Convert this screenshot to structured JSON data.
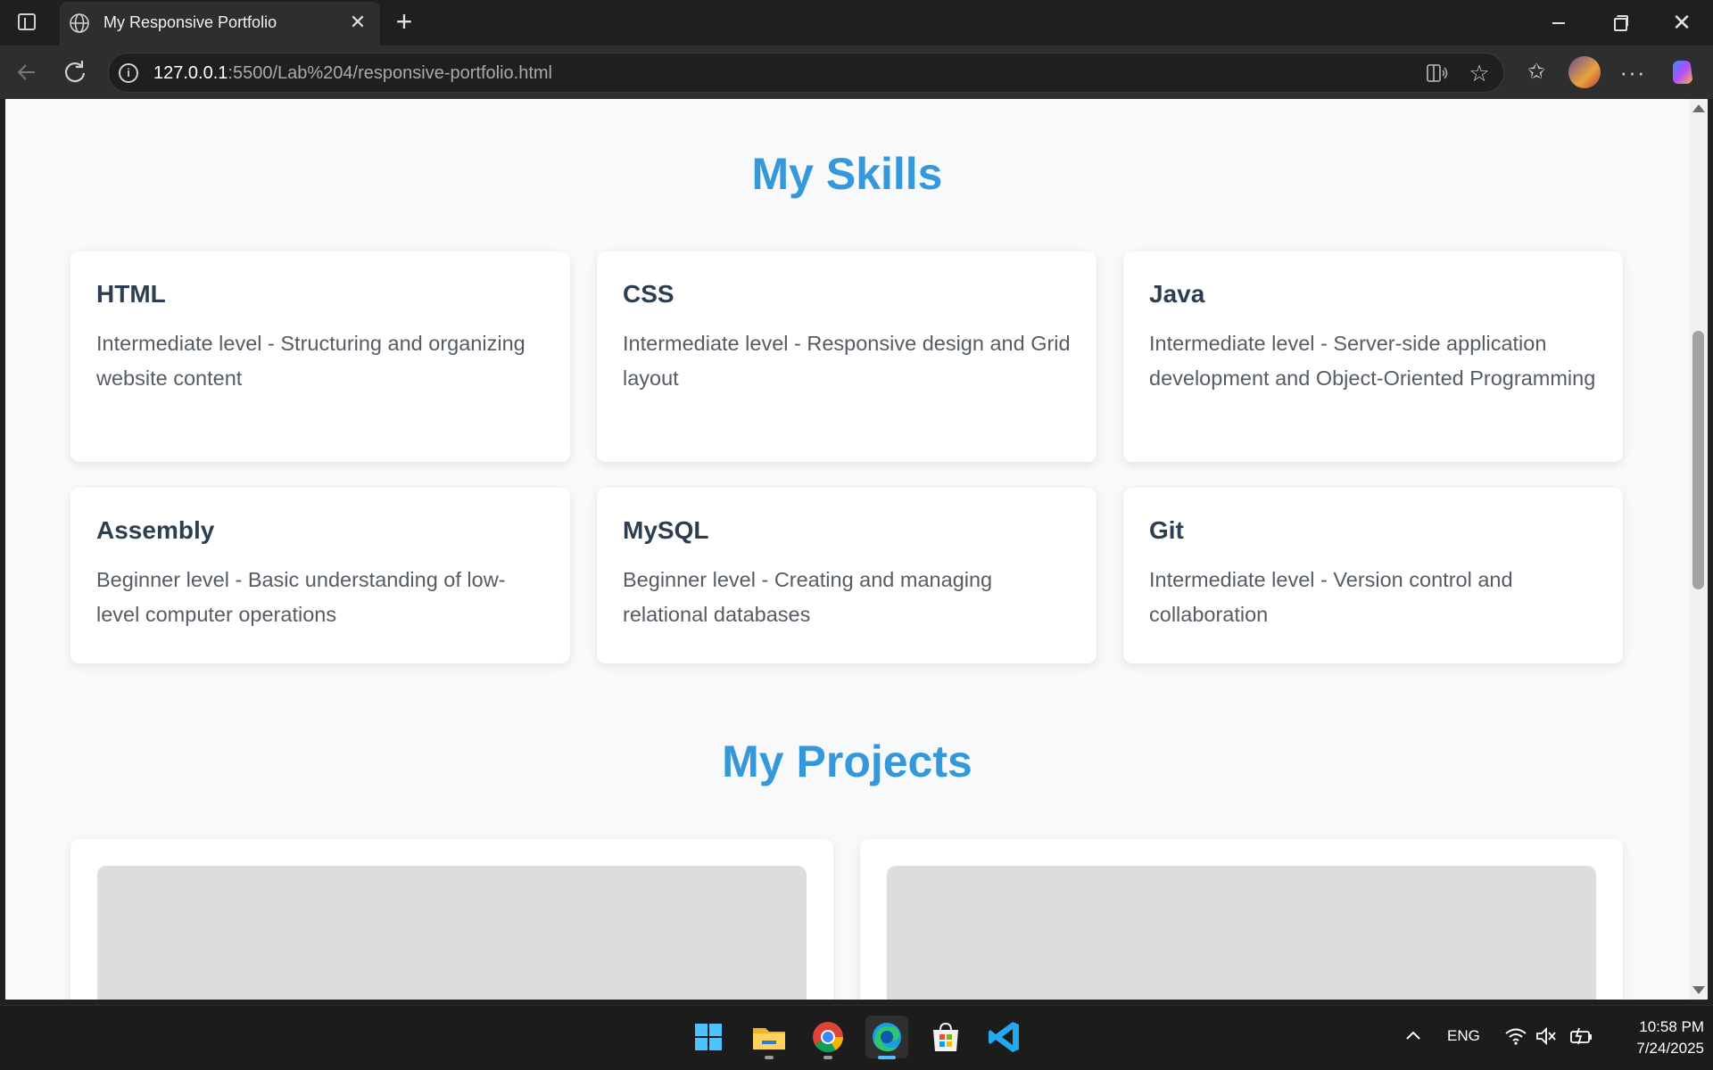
{
  "browser": {
    "tab": {
      "title": "My Responsive Portfolio",
      "close": "✕"
    },
    "new_tab": "+",
    "address": {
      "host": "127.0.0.1",
      "rest": ":5500/Lab%204/responsive-portfolio.html"
    },
    "more": "···"
  },
  "page": {
    "skills_title": "My Skills",
    "skills": [
      {
        "name": "HTML",
        "desc": "Intermediate level - Structuring and organizing website content"
      },
      {
        "name": "CSS",
        "desc": "Intermediate level - Responsive design and Grid layout"
      },
      {
        "name": "Java",
        "desc": "Intermediate level - Server-side application development and Object-Oriented Programming"
      },
      {
        "name": "Assembly",
        "desc": "Beginner level - Basic understanding of low-level computer operations"
      },
      {
        "name": "MySQL",
        "desc": "Beginner level - Creating and managing relational databases"
      },
      {
        "name": "Git",
        "desc": "Intermediate level - Version control and collaboration"
      }
    ],
    "projects_title": "My Projects"
  },
  "taskbar": {
    "apps": [
      "start-icon",
      "file-explorer-icon",
      "chrome-icon",
      "edge-icon",
      "store-icon",
      "vscode-icon"
    ],
    "lang": "ENG",
    "time": "10:58 PM",
    "date": "7/24/2025"
  },
  "colors": {
    "accent": "#3498db",
    "heading": "#2c3e50",
    "page_bg": "#f8f9fa"
  }
}
